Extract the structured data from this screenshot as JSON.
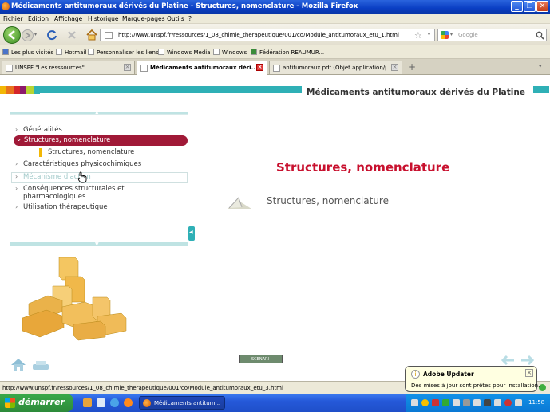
{
  "window": {
    "title": "Médicaments antitumoraux dérivés du Platine - Structures, nomenclature - Mozilla Firefox",
    "minimize_glyph": "_",
    "restore_glyph": "❐",
    "close_glyph": "✕"
  },
  "menu": {
    "items": [
      "Fichier",
      "Édition",
      "Affichage",
      "Historique",
      "Marque-pages",
      "Outils",
      "?"
    ]
  },
  "navbar": {
    "url": "http://www.unspf.fr/ressources/1_08_chimie_therapeutique/001/co/Module_antitumoraux_etu_1.html",
    "search_placeholder": "Google",
    "search_engine_icon": "google-icon"
  },
  "bookmarks": {
    "items": [
      "Les plus visités",
      "Hotmail",
      "Personnaliser les liens",
      "Windows Media",
      "Windows",
      "Fédération REAUMUR..."
    ]
  },
  "tabs": [
    {
      "label": "UNSPF \"Les resssources\"",
      "active": false
    },
    {
      "label": "Médicaments antitumoraux déri...",
      "active": true
    },
    {
      "label": "antitumoraux.pdf (Objet application/pdf)",
      "active": false
    }
  ],
  "page": {
    "header_title": "Médicaments antitumoraux dérivés du Platine",
    "stripe_colors": [
      "#f2b705",
      "#e8731c",
      "#d4252b",
      "#8c1a6b",
      "#b8d432",
      "#2fb0b6"
    ],
    "accent_color": "#a01937",
    "teal_color": "#2fb0b6",
    "menu": [
      {
        "label": "Généralités"
      },
      {
        "label": "Structures, nomenclature",
        "active": true
      },
      {
        "label": "Structures, nomenclature",
        "sub": true
      },
      {
        "label": "Caractéristiques physicochimiques"
      },
      {
        "label": "Mécanisme d'action",
        "hover": true
      },
      {
        "label": "Conséquences structurales et pharmacologiques"
      },
      {
        "label": "Utilisation thérapeutique"
      }
    ],
    "main_title": "Structures, nomenclature",
    "subtitle": "Structures, nomenclature",
    "scenari_label": "SCENARI"
  },
  "status": {
    "text": "http://www.unspf.fr/ressources/1_08_chimie_therapeutique/001/co/Module_antitumoraux_etu_3.html"
  },
  "balloon": {
    "title": "Adobe Updater",
    "message": "Des mises à jour sont prêtes pour installation."
  },
  "taskbar": {
    "start_label": "démarrer",
    "window_label": "Médicaments antitum...",
    "clock": "11:58"
  }
}
